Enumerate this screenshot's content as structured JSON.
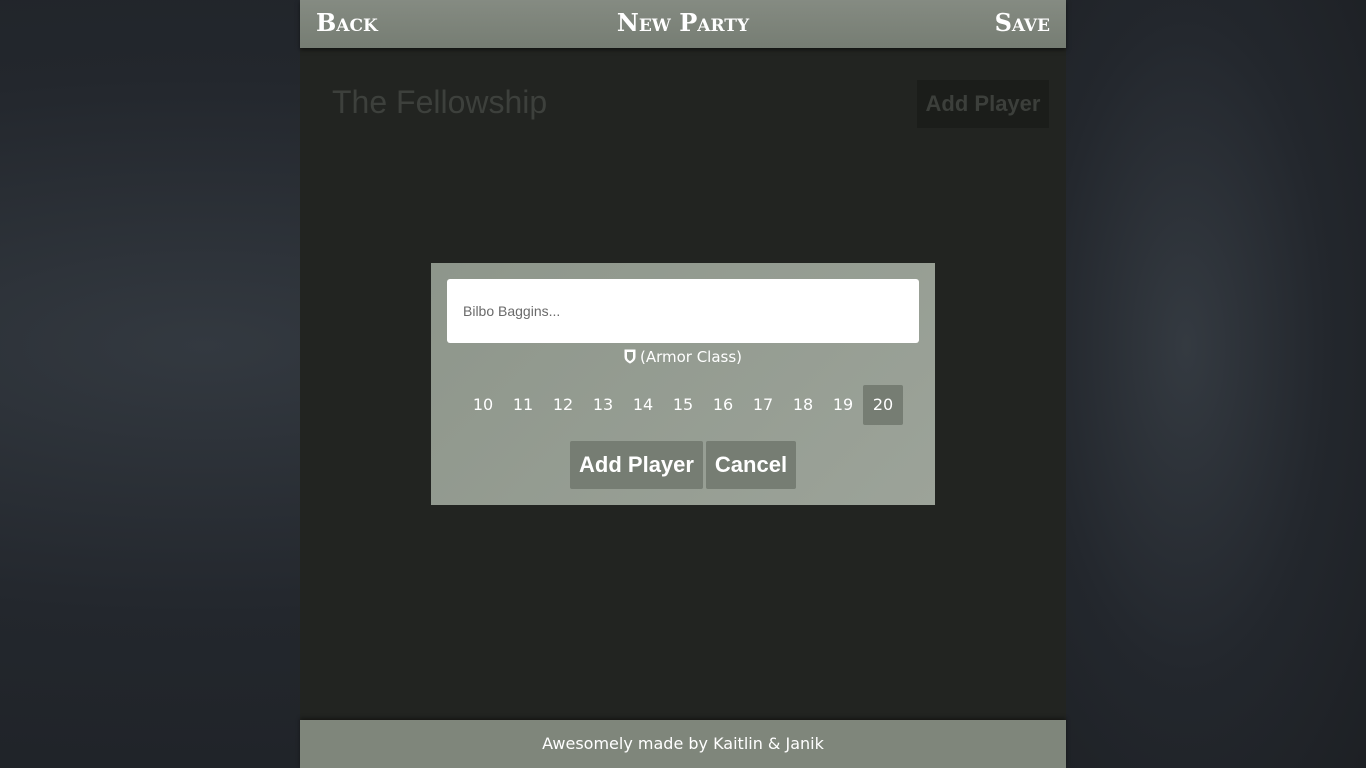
{
  "topbar": {
    "back_label": "Back",
    "title": "New Party",
    "save_label": "Save"
  },
  "party": {
    "name": "The Fellowship",
    "add_player_label": "Add Player"
  },
  "modal": {
    "name_placeholder": "Bilbo Baggins...",
    "ac_icon": "shield-icon",
    "ac_label": "(Armor Class)",
    "ac_options": [
      "10",
      "11",
      "12",
      "13",
      "14",
      "15",
      "16",
      "17",
      "18",
      "19",
      "20"
    ],
    "ac_selected": "20",
    "add_button_label": "Add Player",
    "cancel_button_label": "Cancel"
  },
  "footer": {
    "text": "Awesomely made by Kaitlin & Janik"
  },
  "colors": {
    "header_bg": "#7d8479",
    "modal_bg": "#959d92",
    "button_bg": "#767d73",
    "app_bg": "#222421"
  }
}
